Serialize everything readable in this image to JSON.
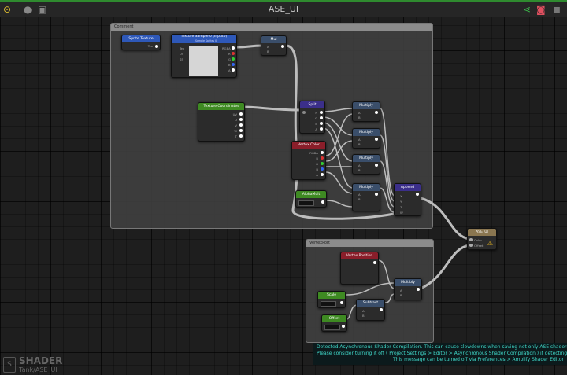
{
  "window": {
    "title": "ASE_UI",
    "icons": {
      "left": [
        "toggle-icon",
        "circle-icon",
        "panel-icon"
      ],
      "right": [
        "share-icon",
        "camera-icon",
        "close-icon"
      ]
    }
  },
  "frames": {
    "comment": {
      "label": "Comment"
    },
    "vertex": {
      "label": "VertexPort"
    }
  },
  "nodes": {
    "sprite_texture": {
      "title": "Sprite Texture",
      "port": "Tex"
    },
    "texture_sample": {
      "title": "Texture Sample 0 (Input0)",
      "subtitle": "Sample Sprites 0",
      "inputs": [
        "Tex",
        "UV",
        "SS"
      ],
      "outputs": [
        "RGBA",
        "R",
        "G",
        "B",
        "A"
      ]
    },
    "mul_top": {
      "title": "Mul",
      "inputs": [
        "A",
        "B"
      ]
    },
    "texcoord": {
      "title": "Texture Coordinates",
      "outputs": [
        "UV",
        "U",
        "V",
        "W",
        "T"
      ]
    },
    "split": {
      "title": "Split",
      "outputs": [
        "R",
        "G",
        "B",
        "A"
      ]
    },
    "vertex_color": {
      "title": "Vertex Color",
      "outputs": [
        "RGBA",
        "R",
        "G",
        "B",
        "A"
      ]
    },
    "alpha_mult": {
      "title": "AlphaMult"
    },
    "multiply1": {
      "title": "Multiply",
      "inputs": [
        "A",
        "B"
      ]
    },
    "multiply2": {
      "title": "Multiply",
      "inputs": [
        "A",
        "B"
      ]
    },
    "multiply3": {
      "title": "Multiply",
      "inputs": [
        "A",
        "B"
      ]
    },
    "multiply4": {
      "title": "Multiply",
      "inputs": [
        "A",
        "B"
      ]
    },
    "append": {
      "title": "Append",
      "inputs": [
        "X",
        "Y",
        "Z",
        "W"
      ]
    },
    "output": {
      "title": "ASE_UI",
      "inputs": [
        "Color",
        "Offset"
      ]
    },
    "vertex_position": {
      "title": "Vertex Position"
    },
    "multiply_v": {
      "title": "Multiply",
      "inputs": [
        "A",
        "B"
      ]
    },
    "scale": {
      "title": "Scale"
    },
    "offset": {
      "title": "Offset"
    },
    "subtract": {
      "title": "Subtract",
      "inputs": [
        "A",
        "B"
      ]
    }
  },
  "console": {
    "lines": [
      "Detected Asynchronous Shader Compilation. This can cause slowdowns when saving not only ASE shaders b",
      "Please consider turning it off ( Project Settings > Editor > Asynchronous Shader Compilation ) if detecting big slo",
      "This message can be turned off via Preferences > Amplify Shader Editor"
    ]
  },
  "shader_info": {
    "label": "SHADER",
    "path": "Tank/ASE_UI"
  },
  "colors": {
    "accent": "#2f8b2f",
    "console_text": "#3fd7c8",
    "wire": "#bdbdbd"
  }
}
